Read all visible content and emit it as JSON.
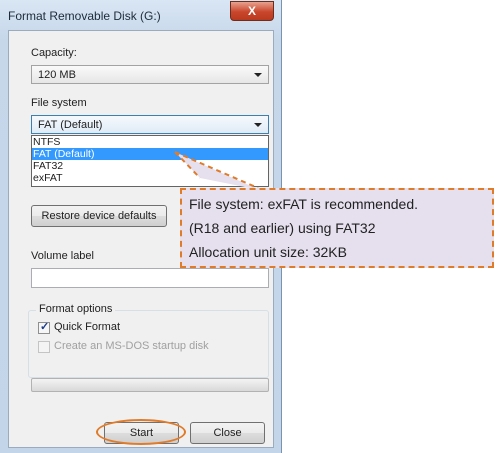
{
  "window": {
    "title": "Format Removable Disk (G:)",
    "close_glyph": "X"
  },
  "capacity": {
    "label": "Capacity:",
    "value": "120 MB"
  },
  "file_system": {
    "label": "File system",
    "value": "FAT (Default)",
    "options": [
      "NTFS",
      "FAT (Default)",
      "FAT32",
      "exFAT"
    ],
    "selected_index": 1
  },
  "restore_button": "Restore device defaults",
  "volume_label": {
    "label": "Volume label",
    "value": ""
  },
  "format_options": {
    "label": "Format options",
    "quick_format": {
      "label": "Quick Format",
      "checked": true
    },
    "msdos_startup": {
      "label": "Create an MS-DOS startup disk",
      "checked": false,
      "disabled": true
    }
  },
  "progress": {
    "fraction": 0
  },
  "buttons": {
    "start": "Start",
    "close": "Close"
  },
  "callout": {
    "lines": [
      "File system: exFAT is recommended.",
      "(R18 and earlier) using FAT32",
      "Allocation unit size: 32KB"
    ],
    "accent_color": "#e07b2a",
    "background_color": "#e6e0ee"
  }
}
